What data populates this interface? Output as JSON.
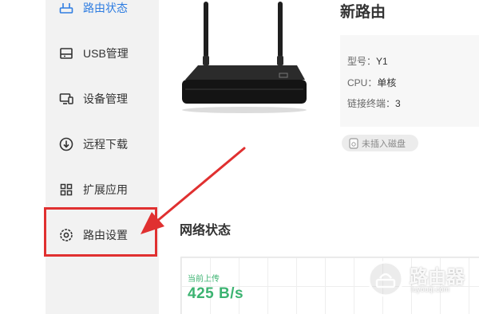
{
  "sidebar": {
    "items": [
      {
        "label": "路由状态",
        "icon": "router-status-icon",
        "active": true
      },
      {
        "label": "USB管理",
        "icon": "usb-icon"
      },
      {
        "label": "设备管理",
        "icon": "device-manage-icon"
      },
      {
        "label": "远程下载",
        "icon": "download-icon"
      },
      {
        "label": "扩展应用",
        "icon": "apps-grid-icon"
      },
      {
        "label": "路由设置",
        "icon": "gear-icon"
      }
    ]
  },
  "device": {
    "title": "新路由",
    "model_label": "型号：",
    "model_value": "Y1",
    "cpu_label": "CPU：",
    "cpu_value": "单核",
    "clients_label": "链接终端：",
    "clients_value": "3",
    "disk_status": "未插入磁盘"
  },
  "network": {
    "title": "网络状态",
    "upload_label": "当前上传",
    "upload_value": "425 B/s"
  },
  "watermark": {
    "text": "路由器",
    "sub": "luyouqi.com"
  },
  "colors": {
    "accent": "#2f7de1",
    "highlight": "#e03030",
    "network_green": "#3cb371",
    "sidebar_bg": "#f2f2f2"
  }
}
